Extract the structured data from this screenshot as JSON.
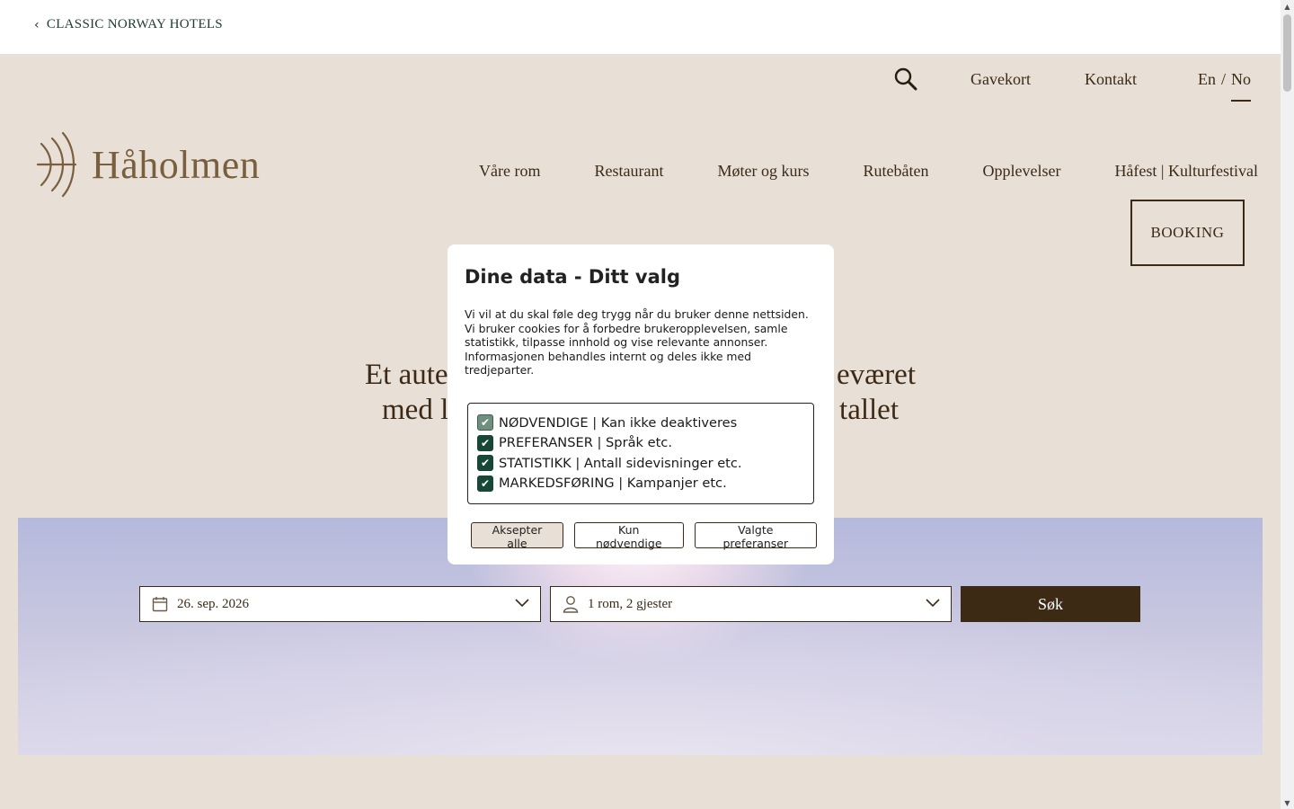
{
  "topbar": {
    "back_label": "CLASSIC NORWAY HOTELS"
  },
  "utility_nav": {
    "gavekort": "Gavekort",
    "kontakt": "Kontakt",
    "lang_en": "En",
    "lang_sep": "/",
    "lang_no": "No",
    "active_language": "No"
  },
  "logo": {
    "text": "Håholmen"
  },
  "main_nav": {
    "items": [
      "Våre rom",
      "Restaurant",
      "Møter og kurs",
      "Rutebåten",
      "Opplevelser",
      "Håfest | Kulturfestival"
    ]
  },
  "booking_button": "BOOKING",
  "headline": {
    "line1_left": "Et aute",
    "line1_right": "eværet",
    "line2_left": "med l",
    "line2_right": "tallet"
  },
  "search": {
    "date_value": "26. sep. 2026",
    "guests_value": "1 rom, 2 gjester",
    "submit_label": "Søk"
  },
  "consent": {
    "title": "Dine data - Ditt valg",
    "body": "Vi vil at du skal føle deg trygg når du bruker denne nettsiden. Vi bruker cookies for å forbedre brukeropplevelsen, samle statistikk, tilpasse innhold og vise relevante annonser. Informasjonen behandles internt og deles ikke med tredjeparter.",
    "options": [
      {
        "label": "NØDVENDIGE | Kan ikke deaktiveres",
        "checked": true,
        "disabled": true
      },
      {
        "label": "PREFERANSER | Språk etc.",
        "checked": true,
        "disabled": false
      },
      {
        "label": "STATISTIKK | Antall sidevisninger etc.",
        "checked": true,
        "disabled": false
      },
      {
        "label": "MARKEDSFØRING | Kampanjer etc.",
        "checked": true,
        "disabled": false
      }
    ],
    "accept_all": "Aksepter alle",
    "only_necessary": "Kun nødvendige",
    "selected_prefs": "Valgte preferanser"
  },
  "colors": {
    "hero_bg": "#e8dfd6",
    "brand_dark": "#3d2a15",
    "checkbox_green": "#174735"
  }
}
